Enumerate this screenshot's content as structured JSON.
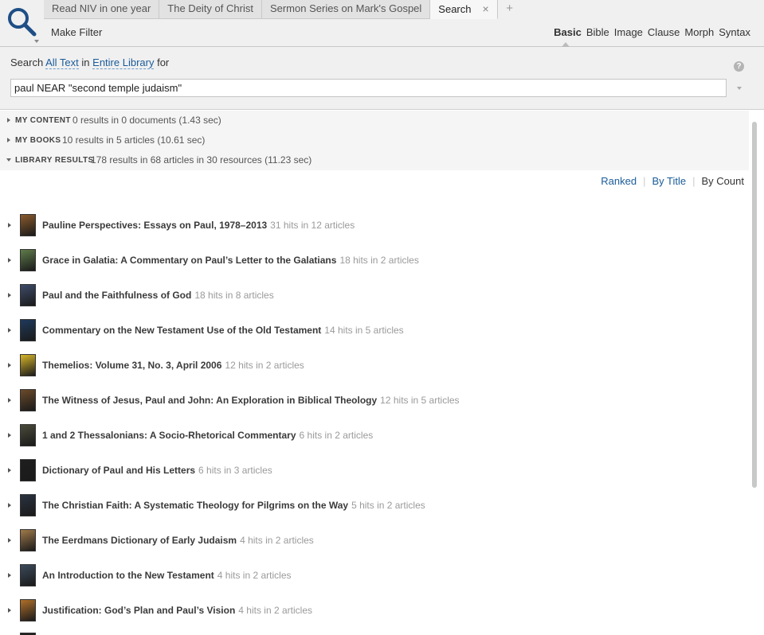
{
  "tabs": [
    {
      "label": "Read NIV in one year",
      "active": false
    },
    {
      "label": "The Deity of Christ",
      "active": false
    },
    {
      "label": "Sermon Series on Mark's Gospel",
      "active": false
    },
    {
      "label": "Search",
      "active": true
    }
  ],
  "tab_close_glyph": "×",
  "tab_add_glyph": "+",
  "toolbar": {
    "make_filter": "Make Filter",
    "modes": [
      "Basic",
      "Bible",
      "Image",
      "Clause",
      "Morph",
      "Syntax"
    ],
    "active_mode": "Basic"
  },
  "search": {
    "prefix": "Search",
    "scope": "All Text",
    "connector": "in",
    "library": "Entire Library",
    "suffix": "for",
    "query": "paul NEAR \"second temple judaism\"",
    "help_glyph": "?"
  },
  "sections": [
    {
      "label": "MY CONTENT",
      "summary": "0 results in 0 documents (1.43 sec)",
      "expanded": false
    },
    {
      "label": "MY BOOKS",
      "summary": "10 results in 5 articles (10.61 sec)",
      "expanded": false
    },
    {
      "label": "LIBRARY RESULTS",
      "summary": "178 results in 68 articles in 30 resources (11.23 sec)",
      "expanded": true
    }
  ],
  "sort": {
    "ranked": "Ranked",
    "by_title": "By Title",
    "by_count": "By Count",
    "separator": "|"
  },
  "results": [
    {
      "title": "Pauline Perspectives: Essays on Paul, 1978–2013",
      "hits": "31 hits in 12 articles",
      "cover_color": "#8a5a2b"
    },
    {
      "title": "Grace in Galatia: A Commentary on Paul’s Letter to the Galatians",
      "hits": "18 hits in 2 articles",
      "cover_color": "#5f7c4a"
    },
    {
      "title": "Paul and the Faithfulness of God",
      "hits": "18 hits in 8 articles",
      "cover_color": "#3e4c6a"
    },
    {
      "title": "Commentary on the New Testament Use of the Old Testament",
      "hits": "14 hits in 5 articles",
      "cover_color": "#1f3a5c"
    },
    {
      "title": "Themelios: Volume 31, No. 3, April 2006",
      "hits": "12 hits in 2 articles",
      "cover_color": "#d7b52a"
    },
    {
      "title": "The Witness of Jesus, Paul and John: An Exploration in Biblical Theology",
      "hits": "12 hits in 5 articles",
      "cover_color": "#6b4a2a"
    },
    {
      "title": "1 and 2 Thessalonians: A Socio-Rhetorical Commentary",
      "hits": "6 hits in 2 articles",
      "cover_color": "#4a4a3a"
    },
    {
      "title": "Dictionary of Paul and His Letters",
      "hits": "6 hits in 3 articles",
      "cover_color": "#1e1e1e"
    },
    {
      "title": "The Christian Faith: A Systematic Theology for Pilgrims on the Way",
      "hits": "5 hits in 2 articles",
      "cover_color": "#2a3340"
    },
    {
      "title": "The Eerdmans Dictionary of Early Judaism",
      "hits": "4 hits in 2 articles",
      "cover_color": "#a07a4a"
    },
    {
      "title": "An Introduction to the New Testament",
      "hits": "4 hits in 2 articles",
      "cover_color": "#3b4a5a"
    },
    {
      "title": "Justification: God’s Plan and Paul’s Vision",
      "hits": "4 hits in 2 articles",
      "cover_color": "#b0702a"
    }
  ]
}
